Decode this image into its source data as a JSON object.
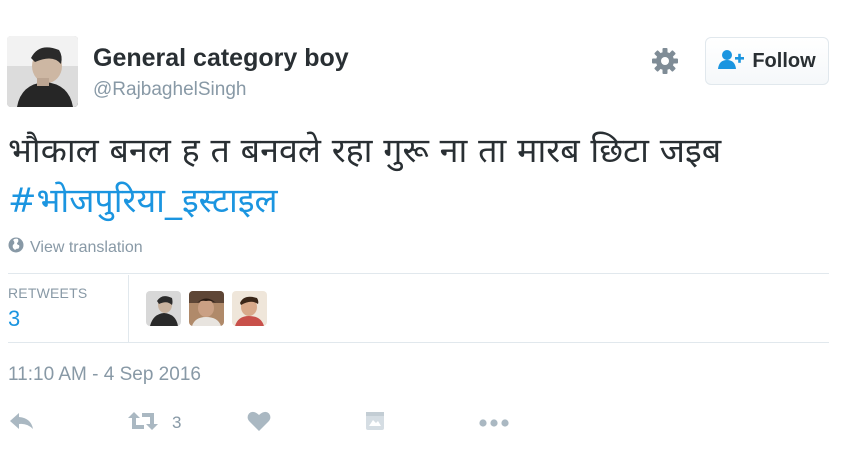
{
  "user": {
    "fullname": "General category boy",
    "handle": "@RajbaghelSingh"
  },
  "follow_button": {
    "label": "Follow"
  },
  "tweet": {
    "text": "भौकाल बनल ह त बनवले रहा गुरू ना ता मारब छिटा जइब ",
    "hashtag": "#भोजपुरिया_इस्टाइल"
  },
  "translation": {
    "label": "View translation"
  },
  "stats": {
    "retweets_label": "RETWEETS",
    "retweets_count": "3"
  },
  "timestamp": "11:10 AM - 4 Sep 2016",
  "actions": {
    "retweet_count": "3"
  },
  "colors": {
    "link": "#1b95e0",
    "meta_text": "#8899a6",
    "icon": "#aab8c2",
    "divider": "#e1e8ed"
  },
  "icons": {
    "settings": "gear-icon",
    "follow": "add-user-icon",
    "translate": "globe-icon",
    "reply": "reply-icon",
    "retweet": "retweet-icon",
    "like": "heart-icon",
    "moment": "moment-icon",
    "more": "more-icon"
  }
}
